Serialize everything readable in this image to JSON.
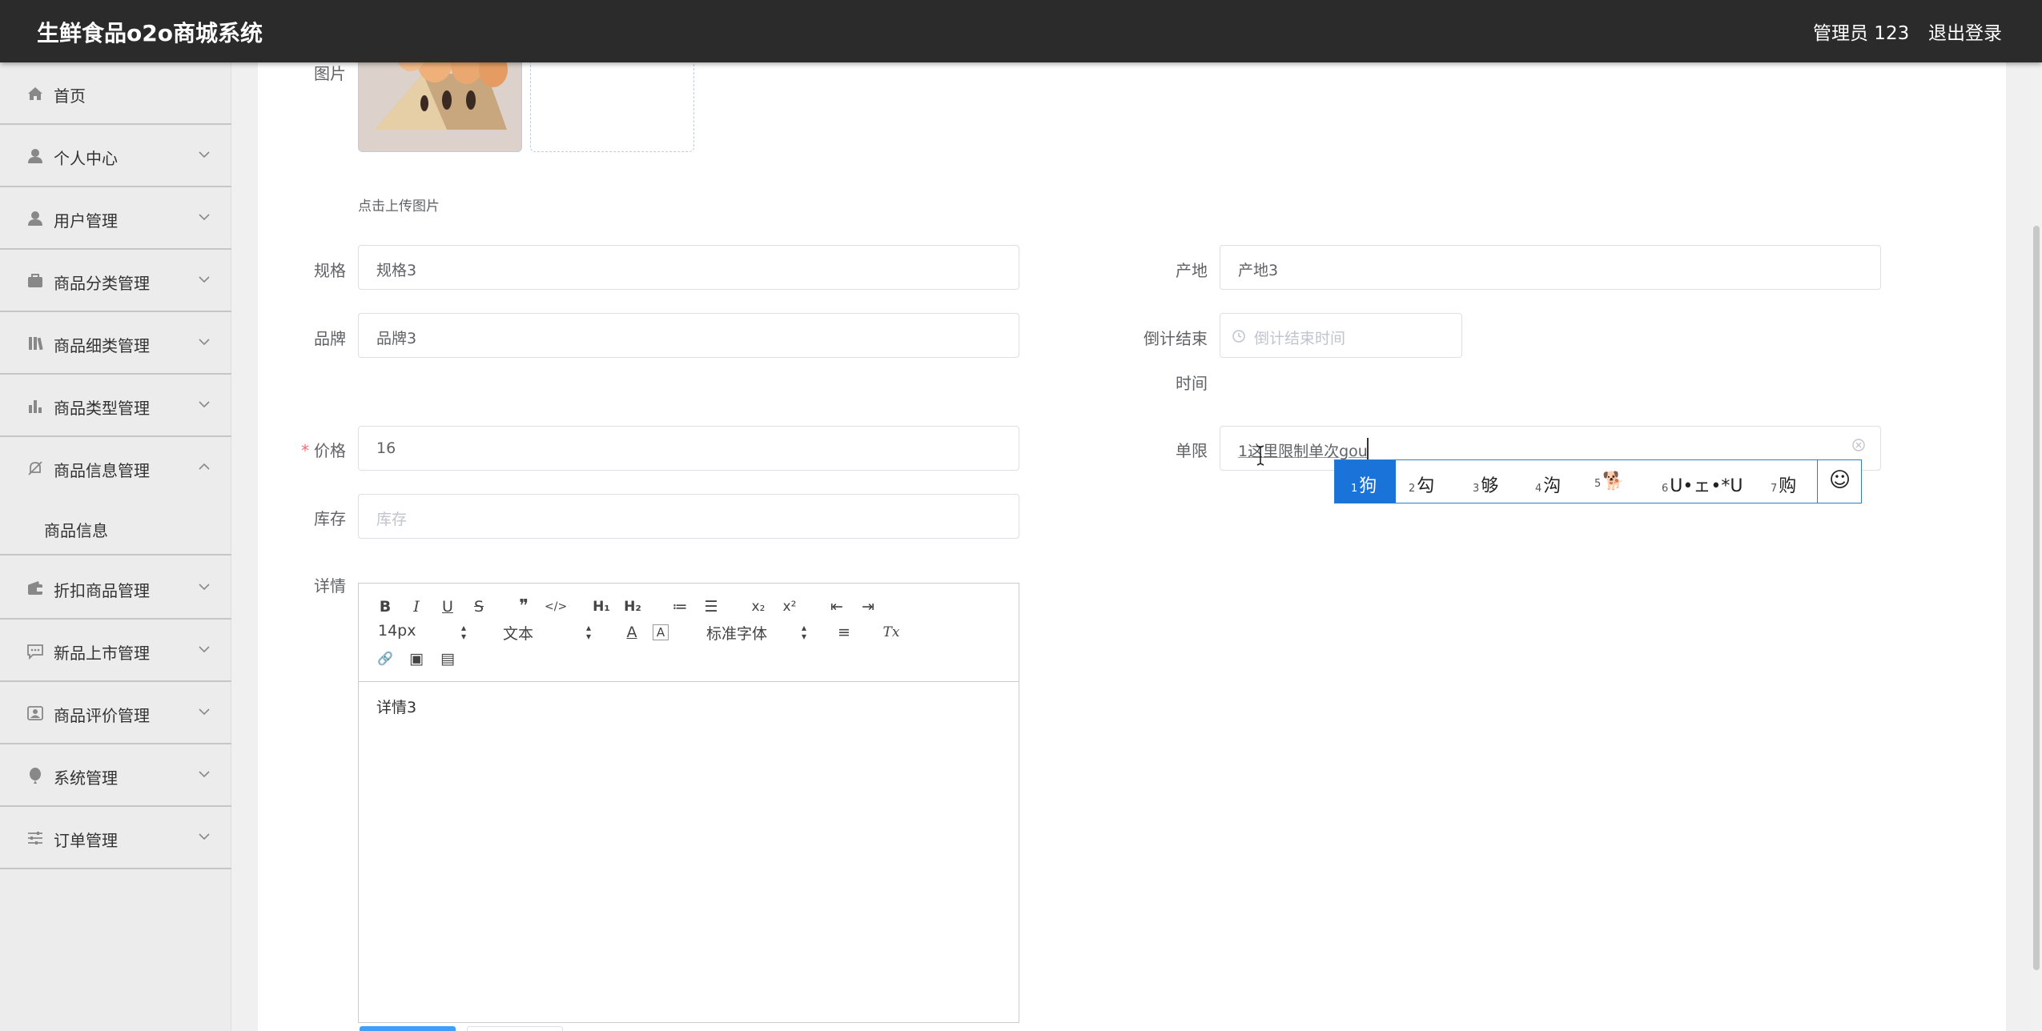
{
  "header": {
    "app_title": "生鲜食品o2o商城系统",
    "user": "管理员 123",
    "logout": "退出登录"
  },
  "sidebar": {
    "items": [
      {
        "label": "首页",
        "icon": "home-icon"
      },
      {
        "label": "个人中心",
        "icon": "user-icon"
      },
      {
        "label": "用户管理",
        "icon": "user-icon"
      },
      {
        "label": "商品分类管理",
        "icon": "briefcase-icon"
      },
      {
        "label": "商品细类管理",
        "icon": "library-icon"
      },
      {
        "label": "商品类型管理",
        "icon": "bar-chart-icon"
      },
      {
        "label": "商品信息管理",
        "icon": "bell-off-icon"
      },
      {
        "label": "折扣商品管理",
        "icon": "wallet-icon"
      },
      {
        "label": "新品上市管理",
        "icon": "chat-icon"
      },
      {
        "label": "商品评价管理",
        "icon": "user-card-icon"
      },
      {
        "label": "系统管理",
        "icon": "balloon-icon"
      },
      {
        "label": "订单管理",
        "icon": "sliders-icon"
      }
    ],
    "subitem": "商品信息"
  },
  "form": {
    "image_label": "图片",
    "upload_tip": "点击上传图片",
    "spec_label": "规格",
    "spec_value": "规格3",
    "origin_label": "产地",
    "origin_value": "产地3",
    "brand_label": "品牌",
    "brand_value": "品牌3",
    "countdown_label_1": "倒计结束",
    "countdown_label_2": "时间",
    "countdown_placeholder": "倒计结束时间",
    "price_required": "*",
    "price_label": "价格",
    "price_value": "16",
    "limit_label": "单限",
    "limit_value": "1这里限制单次gou",
    "stock_label": "库存",
    "stock_placeholder": "库存",
    "detail_label": "详情"
  },
  "editor": {
    "font_size": "14px",
    "header_select": "文本",
    "font_select": "标准字体",
    "content": "详情3",
    "buttons": {
      "bold": "B",
      "italic": "I",
      "underline": "U",
      "strike": "S",
      "quote": "❞",
      "code": "</>",
      "h1": "H₁",
      "h2": "H₂",
      "ordered": "≔",
      "bullet": "☰",
      "sub": "x₂",
      "sup": "x²",
      "outdent": "⇤",
      "indent": "⇥",
      "color": "A",
      "background": "A",
      "align": "≡",
      "clean": "Tx",
      "link": "🔗",
      "image": "▣",
      "video": "▤"
    }
  },
  "ime": {
    "candidates": [
      {
        "num": "1",
        "text": "狗"
      },
      {
        "num": "2",
        "text": "勾"
      },
      {
        "num": "3",
        "text": "够"
      },
      {
        "num": "4",
        "text": "沟"
      },
      {
        "num": "5",
        "text": "🐕"
      },
      {
        "num": "6",
        "text": "U•ェ•*U"
      },
      {
        "num": "7",
        "text": "购"
      }
    ],
    "emoji": "☺"
  }
}
